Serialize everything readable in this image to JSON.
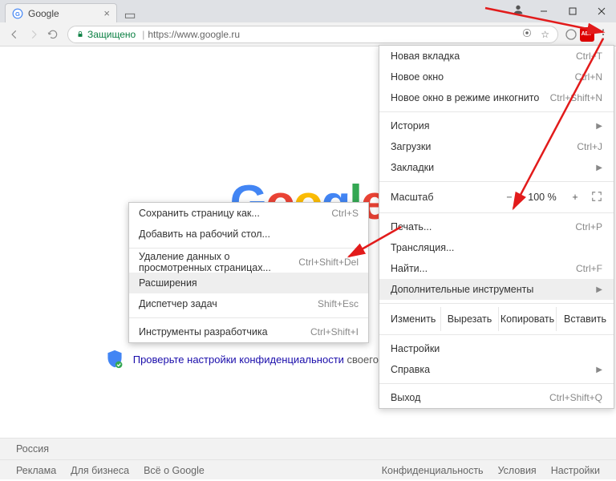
{
  "tab": {
    "title": "Google"
  },
  "address": {
    "secure_label": "Защищено",
    "url": "https://www.google.ru"
  },
  "logo_letters": [
    "G",
    "o",
    "o",
    "g",
    "l",
    "e"
  ],
  "banner": {
    "link_text": "Проверьте настройки конфиденциальности",
    "rest": " своего аккаунта. #DataPrivacyDay"
  },
  "footer": {
    "country": "Россия",
    "left": [
      "Реклама",
      "Для бизнеса",
      "Всё о Google"
    ],
    "right": [
      "Конфиденциальность",
      "Условия",
      "Настройки"
    ]
  },
  "menu": {
    "new_tab": "Новая вкладка",
    "new_tab_kb": "Ctrl+T",
    "new_window": "Новое окно",
    "new_window_kb": "Ctrl+N",
    "incognito": "Новое окно в режиме инкогнито",
    "incognito_kb": "Ctrl+Shift+N",
    "history": "История",
    "downloads": "Загрузки",
    "downloads_kb": "Ctrl+J",
    "bookmarks": "Закладки",
    "zoom_label": "Масштаб",
    "zoom_minus": "−",
    "zoom_val": "100 %",
    "zoom_plus": "+",
    "print": "Печать...",
    "print_kb": "Ctrl+P",
    "cast": "Трансляция...",
    "find": "Найти...",
    "find_kb": "Ctrl+F",
    "more_tools": "Дополнительные инструменты",
    "edit_label": "Изменить",
    "cut": "Вырезать",
    "copy": "Копировать",
    "paste": "Вставить",
    "settings": "Настройки",
    "help": "Справка",
    "exit": "Выход",
    "exit_kb": "Ctrl+Shift+Q"
  },
  "submenu": {
    "save_as": "Сохранить страницу как...",
    "save_as_kb": "Ctrl+S",
    "add_desktop": "Добавить на рабочий стол...",
    "clear_data": "Удаление данных о просмотренных страницах...",
    "clear_data_kb": "Ctrl+Shift+Del",
    "extensions": "Расширения",
    "task_mgr": "Диспетчер задач",
    "task_mgr_kb": "Shift+Esc",
    "devtools": "Инструменты разработчика",
    "devtools_kb": "Ctrl+Shift+I"
  }
}
